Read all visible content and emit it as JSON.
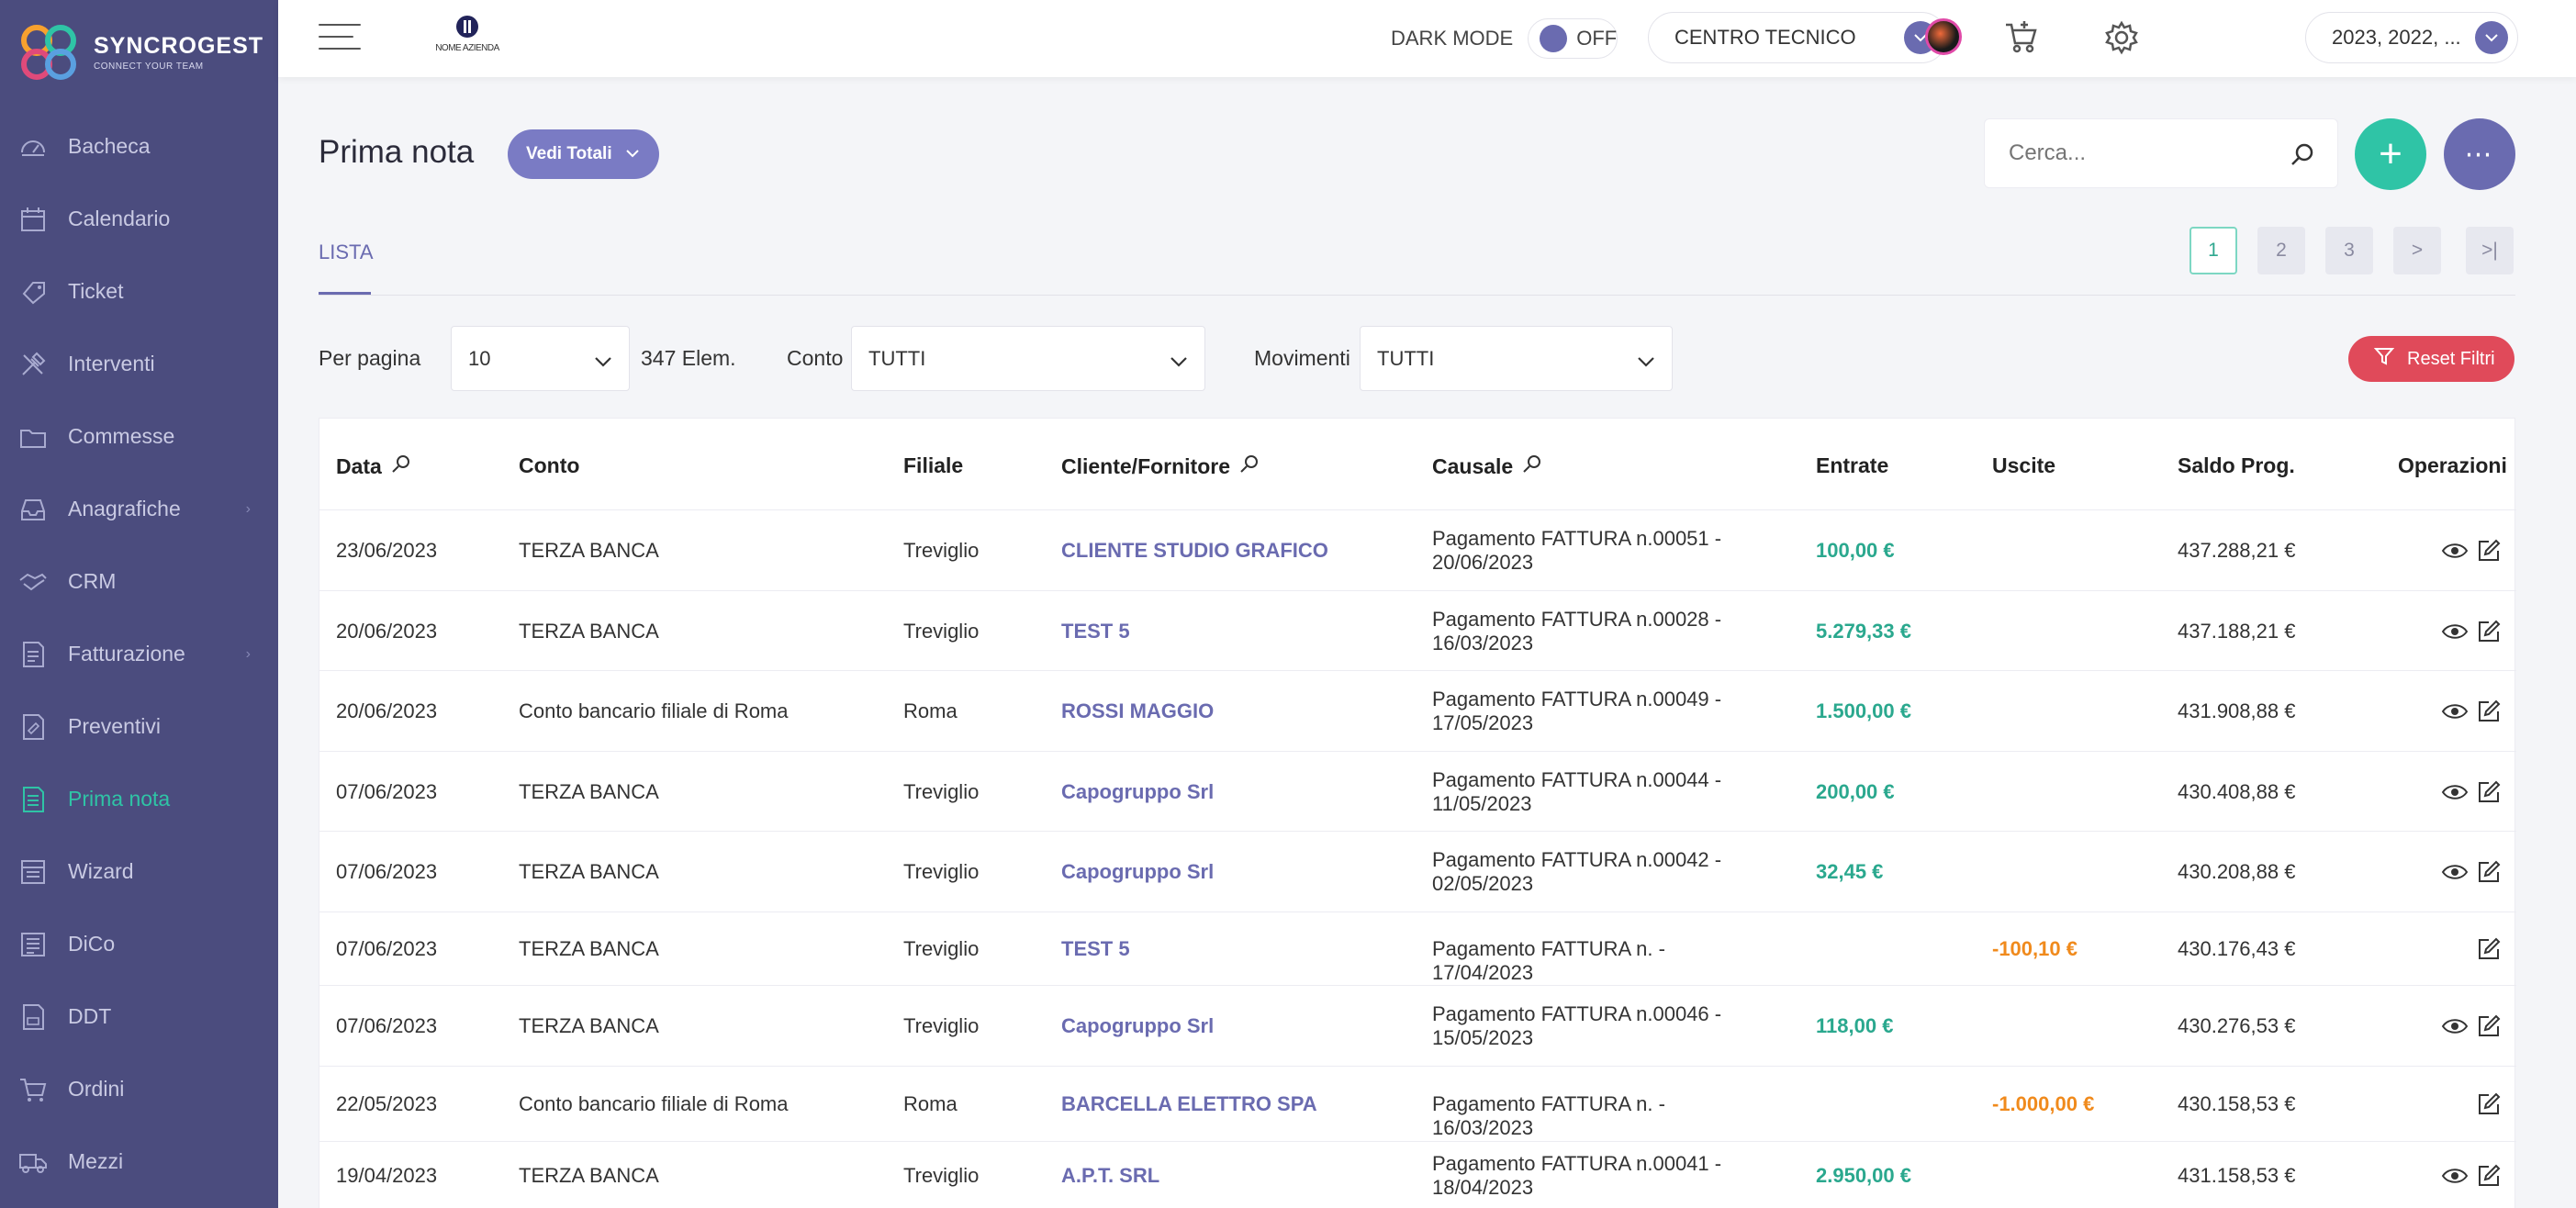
{
  "brand": {
    "name": "SYNCROGEST",
    "tagline": "CONNECT YOUR TEAM",
    "colors": {
      "sidebar": "#4b4c7e",
      "accent": "#6a6bb0",
      "green": "#2fc4a6",
      "red": "#e04a5a",
      "orange": "#f08a1c"
    }
  },
  "sidebar": {
    "items": [
      {
        "label": "Bacheca",
        "icon": "dashboard-icon"
      },
      {
        "label": "Calendario",
        "icon": "calendar-icon"
      },
      {
        "label": "Ticket",
        "icon": "ticket-icon"
      },
      {
        "label": "Interventi",
        "icon": "tools-icon"
      },
      {
        "label": "Commesse",
        "icon": "folder-icon"
      },
      {
        "label": "Anagrafiche",
        "icon": "inbox-icon",
        "chevron": "›"
      },
      {
        "label": "CRM",
        "icon": "handshake-icon"
      },
      {
        "label": "Fatturazione",
        "icon": "invoice-icon",
        "chevron": "›"
      },
      {
        "label": "Preventivi",
        "icon": "quote-icon"
      },
      {
        "label": "Prima nota",
        "icon": "ledger-icon",
        "active": true
      },
      {
        "label": "Wizard",
        "icon": "wizard-icon"
      },
      {
        "label": "DiCo",
        "icon": "dico-icon"
      },
      {
        "label": "DDT",
        "icon": "ddt-icon"
      },
      {
        "label": "Ordini",
        "icon": "cart-icon"
      },
      {
        "label": "Mezzi",
        "icon": "truck-icon"
      }
    ]
  },
  "topbar": {
    "company_label": "NOME AZIENDA",
    "dark_mode_label": "DARK MODE",
    "dark_mode_state": "OFF",
    "center_select": "CENTRO TECNICO",
    "years_select": "2023, 2022, ..."
  },
  "header": {
    "title": "Prima nota",
    "totals_button": "Vedi Totali",
    "search_placeholder": "Cerca...",
    "add_label": "+",
    "more_label": "⋯"
  },
  "tabs": {
    "active": "LISTA"
  },
  "pagination": [
    "1",
    "2",
    "3",
    ">",
    ">|"
  ],
  "filters": {
    "per_page_label": "Per pagina",
    "per_page_value": "10",
    "count": "347 Elem.",
    "conto_label": "Conto",
    "conto_value": "TUTTI",
    "movimenti_label": "Movimenti",
    "movimenti_value": "TUTTI",
    "reset_label": "Reset Filtri"
  },
  "table": {
    "columns": [
      "Data",
      "Conto",
      "Filiale",
      "Cliente/Fornitore",
      "Causale",
      "Entrate",
      "Uscite",
      "Saldo Prog.",
      "Operazioni"
    ],
    "rows": [
      {
        "data": "23/06/2023",
        "conto": "TERZA BANCA",
        "filiale": "Treviglio",
        "cliente": "CLIENTE STUDIO GRAFICO",
        "causale1": "Pagamento FATTURA n.00051 -",
        "causale2": "20/06/2023",
        "entrate": "100,00 €",
        "uscite": "",
        "saldo": "437.288,21 €",
        "view": true
      },
      {
        "data": "20/06/2023",
        "conto": "TERZA BANCA",
        "filiale": "Treviglio",
        "cliente": "TEST 5",
        "causale1": "Pagamento FATTURA n.00028 -",
        "causale2": "16/03/2023",
        "entrate": "5.279,33 €",
        "uscite": "",
        "saldo": "437.188,21 €",
        "view": true
      },
      {
        "data": "20/06/2023",
        "conto": "Conto bancario filiale di Roma",
        "filiale": "Roma",
        "cliente": "ROSSI MAGGIO",
        "causale1": "Pagamento FATTURA n.00049 -",
        "causale2": "17/05/2023",
        "entrate": "1.500,00 €",
        "uscite": "",
        "saldo": "431.908,88 €",
        "view": true
      },
      {
        "data": "07/06/2023",
        "conto": "TERZA BANCA",
        "filiale": "Treviglio",
        "cliente": "Capogruppo Srl",
        "causale1": "Pagamento FATTURA n.00044 -",
        "causale2": "11/05/2023",
        "entrate": "200,00 €",
        "uscite": "",
        "saldo": "430.408,88 €",
        "view": true
      },
      {
        "data": "07/06/2023",
        "conto": "TERZA BANCA",
        "filiale": "Treviglio",
        "cliente": "Capogruppo Srl",
        "causale1": "Pagamento FATTURA n.00042 -",
        "causale2": "02/05/2023",
        "entrate": "32,45 €",
        "uscite": "",
        "saldo": "430.208,88 €",
        "view": true
      },
      {
        "data": "07/06/2023",
        "conto": "TERZA BANCA",
        "filiale": "Treviglio",
        "cliente": "TEST 5",
        "causale1": "Pagamento FATTURA n. - 17/04/2023",
        "causale2": "",
        "entrate": "",
        "uscite": "-100,10 €",
        "saldo": "430.176,43 €",
        "view": false
      },
      {
        "data": "07/06/2023",
        "conto": "TERZA BANCA",
        "filiale": "Treviglio",
        "cliente": "Capogruppo Srl",
        "causale1": "Pagamento FATTURA n.00046 -",
        "causale2": "15/05/2023",
        "entrate": "118,00 €",
        "uscite": "",
        "saldo": "430.276,53 €",
        "view": true
      },
      {
        "data": "22/05/2023",
        "conto": "Conto bancario filiale di Roma",
        "filiale": "Roma",
        "cliente": "BARCELLA ELETTRO SPA",
        "causale1": "Pagamento FATTURA n. - 16/03/2023",
        "causale2": "",
        "entrate": "",
        "uscite": "-1.000,00 €",
        "saldo": "430.158,53 €",
        "view": false
      },
      {
        "data": "19/04/2023",
        "conto": "TERZA BANCA",
        "filiale": "Treviglio",
        "cliente": "A.P.T. SRL",
        "causale1": "Pagamento FATTURA n.00041 -",
        "causale2": "18/04/2023",
        "entrate": "2.950,00 €",
        "uscite": "",
        "saldo": "431.158,53 €",
        "view": true
      }
    ]
  }
}
